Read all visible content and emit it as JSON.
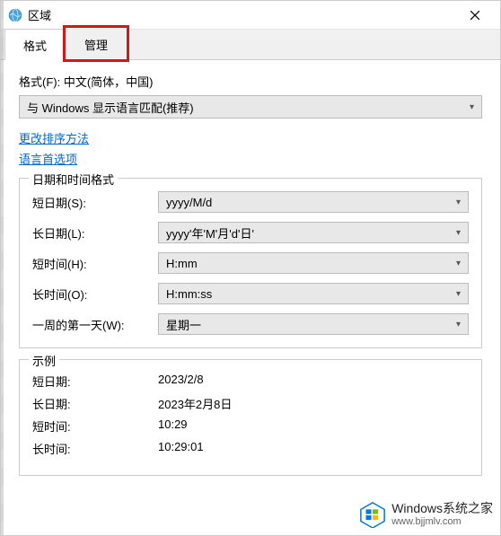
{
  "window": {
    "title": "区域"
  },
  "tabs": {
    "format": "格式",
    "admin": "管理"
  },
  "format_section": {
    "label": "格式(F): 中文(简体，中国)",
    "selected": "与 Windows 显示语言匹配(推荐)"
  },
  "links": {
    "sort_method": "更改排序方法",
    "lang_prefs": "语言首选项"
  },
  "datetime_group": {
    "title": "日期和时间格式",
    "rows": [
      {
        "label": "短日期(S):",
        "value": "yyyy/M/d"
      },
      {
        "label": "长日期(L):",
        "value": "yyyy'年'M'月'd'日'"
      },
      {
        "label": "短时间(H):",
        "value": "H:mm"
      },
      {
        "label": "长时间(O):",
        "value": "H:mm:ss"
      },
      {
        "label": "一周的第一天(W):",
        "value": "星期一"
      }
    ]
  },
  "example_group": {
    "title": "示例",
    "rows": [
      {
        "label": "短日期:",
        "value": "2023/2/8"
      },
      {
        "label": "长日期:",
        "value": "2023年2月8日"
      },
      {
        "label": "短时间:",
        "value": "10:29"
      },
      {
        "label": "长时间:",
        "value": "10:29:01"
      }
    ]
  },
  "watermark": {
    "text_main": "Windows系统之家",
    "text_url": "www.bjjmlv.com"
  },
  "colors": {
    "link": "#0066cc",
    "highlight": "#d01818",
    "logo_blue": "#0078d4",
    "logo_green": "#7fba00",
    "logo_orange": "#ffb900"
  }
}
